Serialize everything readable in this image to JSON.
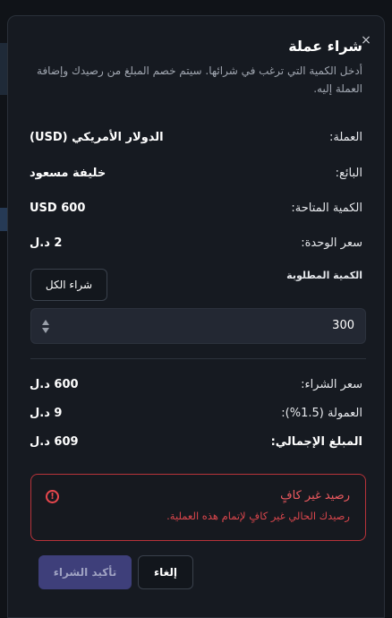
{
  "dialog": {
    "title": "شراء عملة",
    "description": "أدخل الكمية التي ترغب في شرائها. سيتم خصم المبلغ من رصيدك وإضافة العملة إليه.",
    "close_glyph": "×"
  },
  "details": {
    "currency_label": "العملة:",
    "currency_value": "الدولار الأمريكي (USD)",
    "seller_label": "البائع:",
    "seller_value": "خليفة مسعود",
    "available_label": "الكمية المتاحة:",
    "available_value": "USD 600",
    "unit_price_label": "سعر الوحدة:",
    "unit_price_value": "2 د.ل"
  },
  "quantity": {
    "label": "الكمية المطلوبة",
    "buy_all_label": "شراء الكل",
    "value": "300"
  },
  "summary": {
    "purchase_price_label": "سعر الشراء:",
    "purchase_price_value": "600 د.ل",
    "commission_label": "العمولة (1.5%):",
    "commission_value": "9 د.ل",
    "total_label": "المبلغ الإجمالي:",
    "total_value": "609 د.ل"
  },
  "alert": {
    "icon_glyph": "!",
    "title": "رصيد غير كافٍ",
    "message": "رصيدك الحالي غير كافٍ لإتمام هذه العملية."
  },
  "actions": {
    "confirm_label": "تأكيد الشراء",
    "cancel_label": "إلغاء"
  },
  "colors": {
    "accent": "#3e3f7a",
    "error": "#e8474d",
    "surface": "#161a21"
  }
}
